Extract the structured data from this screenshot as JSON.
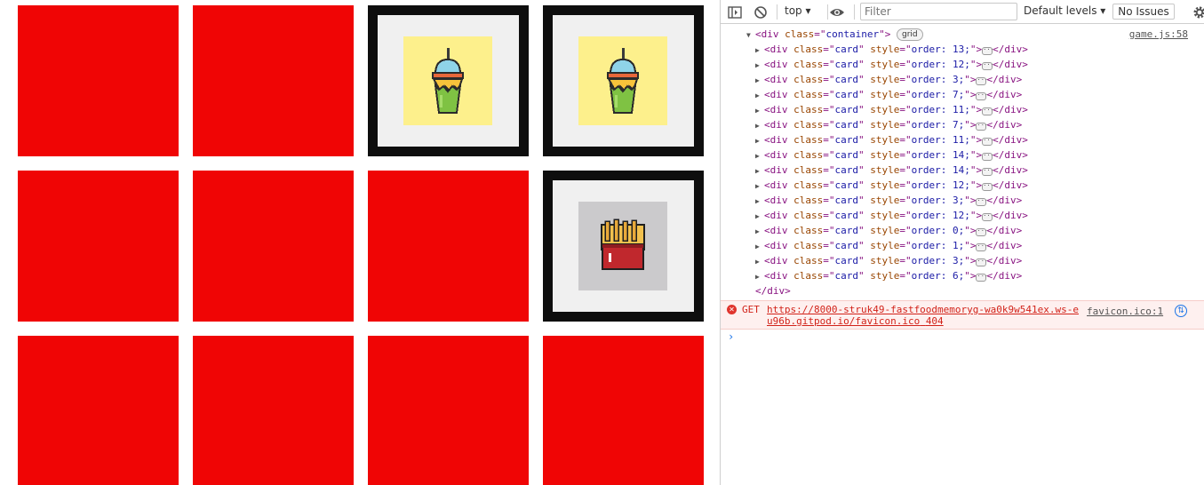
{
  "game": {
    "cards": [
      {
        "state": "back"
      },
      {
        "state": "back"
      },
      {
        "state": "face",
        "image": "slushie-drink",
        "bg": "yellow"
      },
      {
        "state": "face",
        "image": "slushie-drink",
        "bg": "yellow"
      },
      {
        "state": "back"
      },
      {
        "state": "back"
      },
      {
        "state": "back"
      },
      {
        "state": "face",
        "image": "french-fries",
        "bg": "grey"
      },
      {
        "state": "back"
      },
      {
        "state": "back"
      },
      {
        "state": "back"
      },
      {
        "state": "back"
      }
    ],
    "colors": {
      "card_back": "#f00505",
      "card_frame": "#0e0e0e",
      "card_inner": "#f0f0f0",
      "yellow_bg": "#fdf08c",
      "grey_bg": "#cbcacc"
    }
  },
  "devtools": {
    "toolbar": {
      "context": "top",
      "filter_placeholder": "Filter",
      "levels_label": "Default levels",
      "issues_label": "No Issues",
      "icons": [
        "sidebar-toggle-icon",
        "clear-console-icon",
        "eye-icon",
        "gear-icon"
      ]
    },
    "container": {
      "open_tag": "div",
      "attr_name": "class",
      "attr_value": "container",
      "badge": "grid",
      "source": "game.js:58",
      "close_tag": "</div>"
    },
    "children": [
      {
        "tag": "div",
        "cls": "card",
        "style": "order: 13;"
      },
      {
        "tag": "div",
        "cls": "card",
        "style": "order: 12;"
      },
      {
        "tag": "div",
        "cls": "card",
        "style": "order: 3;"
      },
      {
        "tag": "div",
        "cls": "card",
        "style": "order: 7;"
      },
      {
        "tag": "div",
        "cls": "card",
        "style": "order: 11;"
      },
      {
        "tag": "div",
        "cls": "card",
        "style": "order: 7;"
      },
      {
        "tag": "div",
        "cls": "card",
        "style": "order: 11;"
      },
      {
        "tag": "div",
        "cls": "card",
        "style": "order: 14;"
      },
      {
        "tag": "div",
        "cls": "card",
        "style": "order: 14;"
      },
      {
        "tag": "div",
        "cls": "card",
        "style": "order: 12;"
      },
      {
        "tag": "div",
        "cls": "card",
        "style": "order: 3;"
      },
      {
        "tag": "div",
        "cls": "card",
        "style": "order: 12;"
      },
      {
        "tag": "div",
        "cls": "card",
        "style": "order: 0;"
      },
      {
        "tag": "div",
        "cls": "card",
        "style": "order: 1;"
      },
      {
        "tag": "div",
        "cls": "card",
        "style": "order: 3;"
      },
      {
        "tag": "div",
        "cls": "card",
        "style": "order: 6;"
      }
    ],
    "error": {
      "method": "GET",
      "url": "https://8000-struk49-fastfoodmemoryg-wa0k9w541ex.ws-eu96b.gitpod.io/favicon.ico",
      "status": "404",
      "source": "favicon.ico:1"
    },
    "prompt": "›"
  }
}
